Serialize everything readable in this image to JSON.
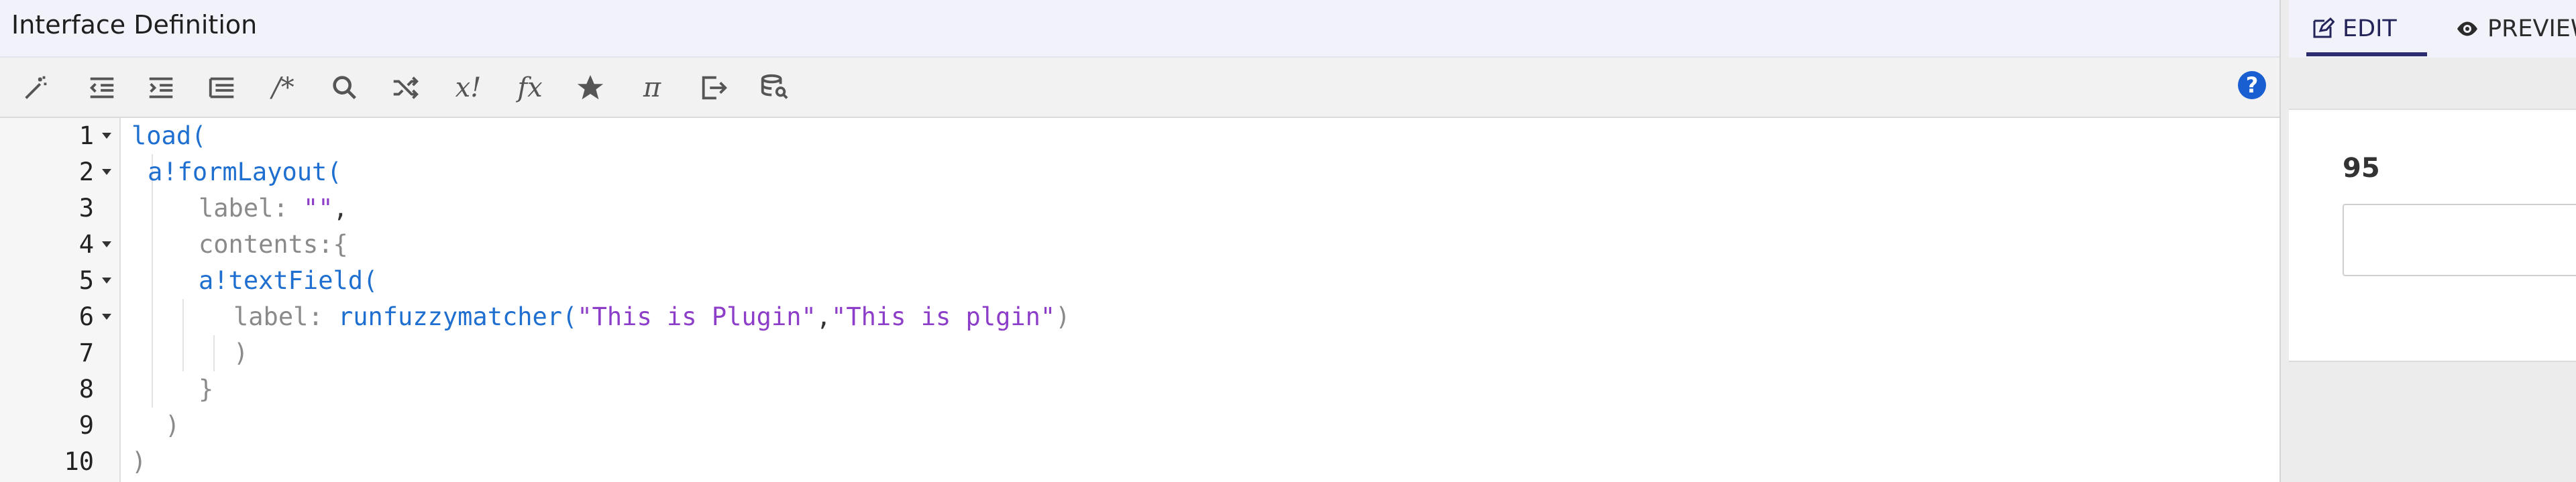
{
  "editor": {
    "title": "Interface Definition",
    "help_label": "?",
    "toolbar": [
      {
        "name": "wand-icon"
      },
      {
        "name": "outdent-icon"
      },
      {
        "name": "indent-icon"
      },
      {
        "name": "list-icon"
      },
      {
        "name": "comment-icon",
        "text": "/*"
      },
      {
        "name": "search-icon"
      },
      {
        "name": "shuffle-icon"
      },
      {
        "name": "x-bang-icon",
        "text": "x!"
      },
      {
        "name": "function-icon",
        "text": "fx"
      },
      {
        "name": "star-icon"
      },
      {
        "name": "pi-icon",
        "text": "π"
      },
      {
        "name": "export-icon"
      },
      {
        "name": "database-search-icon"
      }
    ],
    "line_numbers": [
      "1",
      "2",
      "3",
      "4",
      "5",
      "6",
      "7",
      "8",
      "9",
      "10"
    ],
    "code": {
      "l1": "load(",
      "l2": "a!formLayout(",
      "l3_prop": "label:",
      "l3_str": "\"\"",
      "l3_rest": ",",
      "l4": "contents:{",
      "l5": "a!textField(",
      "l6_prop": "label:",
      "l6_fn": "runfuzzymatcher(",
      "l6_str1": "\"This is Plugin\"",
      "l6_comma": ",",
      "l6_str2": "\"This is plgin\"",
      "l6_close": ")",
      "l7": ")",
      "l8": "}",
      "l9": ")",
      "l10": ")"
    }
  },
  "preview": {
    "tabs": [
      {
        "label": "EDIT",
        "icon": "edit-icon"
      },
      {
        "label": "PREVIEW",
        "icon": "eye-icon"
      }
    ],
    "value_label": "95",
    "input_value": ""
  },
  "colors": {
    "keyword": "#1f6fd0",
    "property": "#8a8a8a",
    "string": "#8d3ec9",
    "accent": "#2c2c70",
    "help": "#1a5fd1"
  }
}
